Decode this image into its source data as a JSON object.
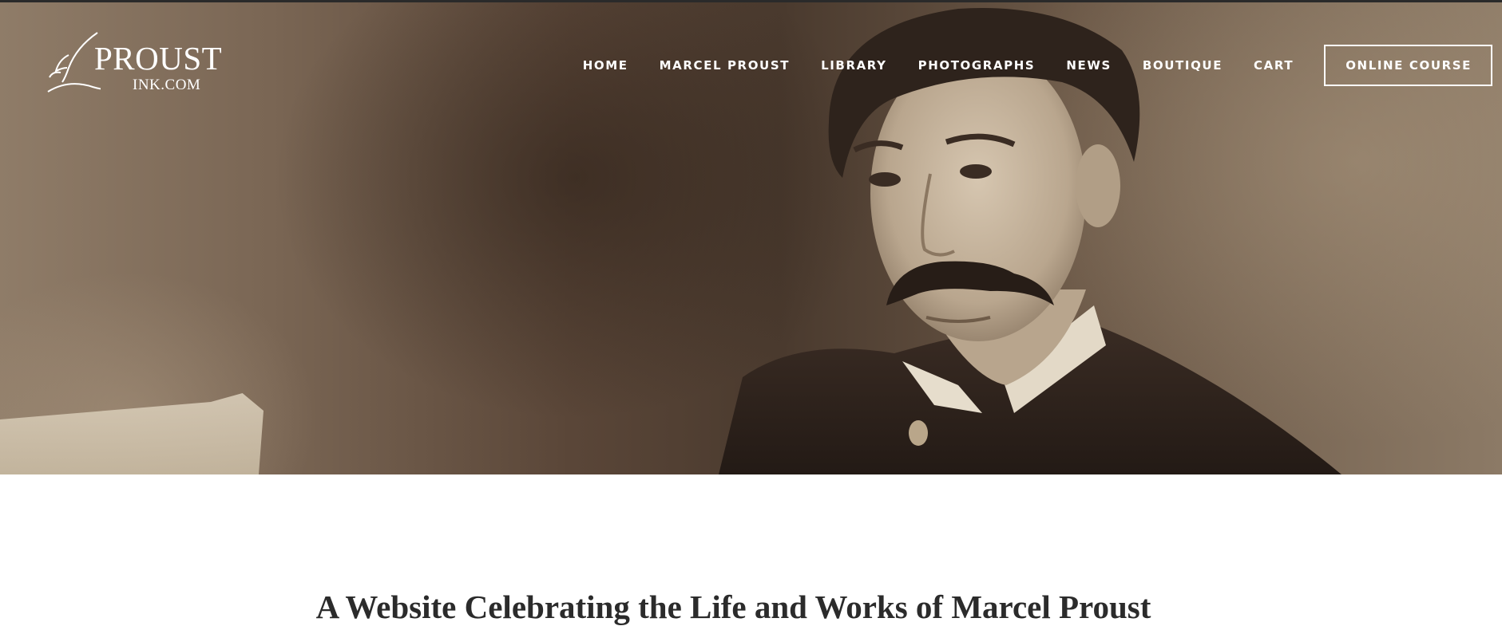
{
  "site": {
    "logo": {
      "name": "PROUST",
      "domain": "INK.COM",
      "icon": "quill-pen-icon"
    }
  },
  "nav": {
    "items": [
      {
        "label": "HOME"
      },
      {
        "label": "MARCEL PROUST"
      },
      {
        "label": "LIBRARY"
      },
      {
        "label": "PHOTOGRAPHS"
      },
      {
        "label": "NEWS"
      },
      {
        "label": "BOUTIQUE"
      },
      {
        "label": "CART"
      }
    ],
    "cta_label": "ONLINE COURSE"
  },
  "hero": {
    "image": "sepia-portrait-of-marcel-proust"
  },
  "intro": {
    "tagline": "A Website Celebrating the Life and Works of Marcel Proust"
  },
  "colors": {
    "text_dark": "#2b2b2b",
    "nav_text": "#ffffff",
    "hero_sepia": "#5a4638"
  }
}
